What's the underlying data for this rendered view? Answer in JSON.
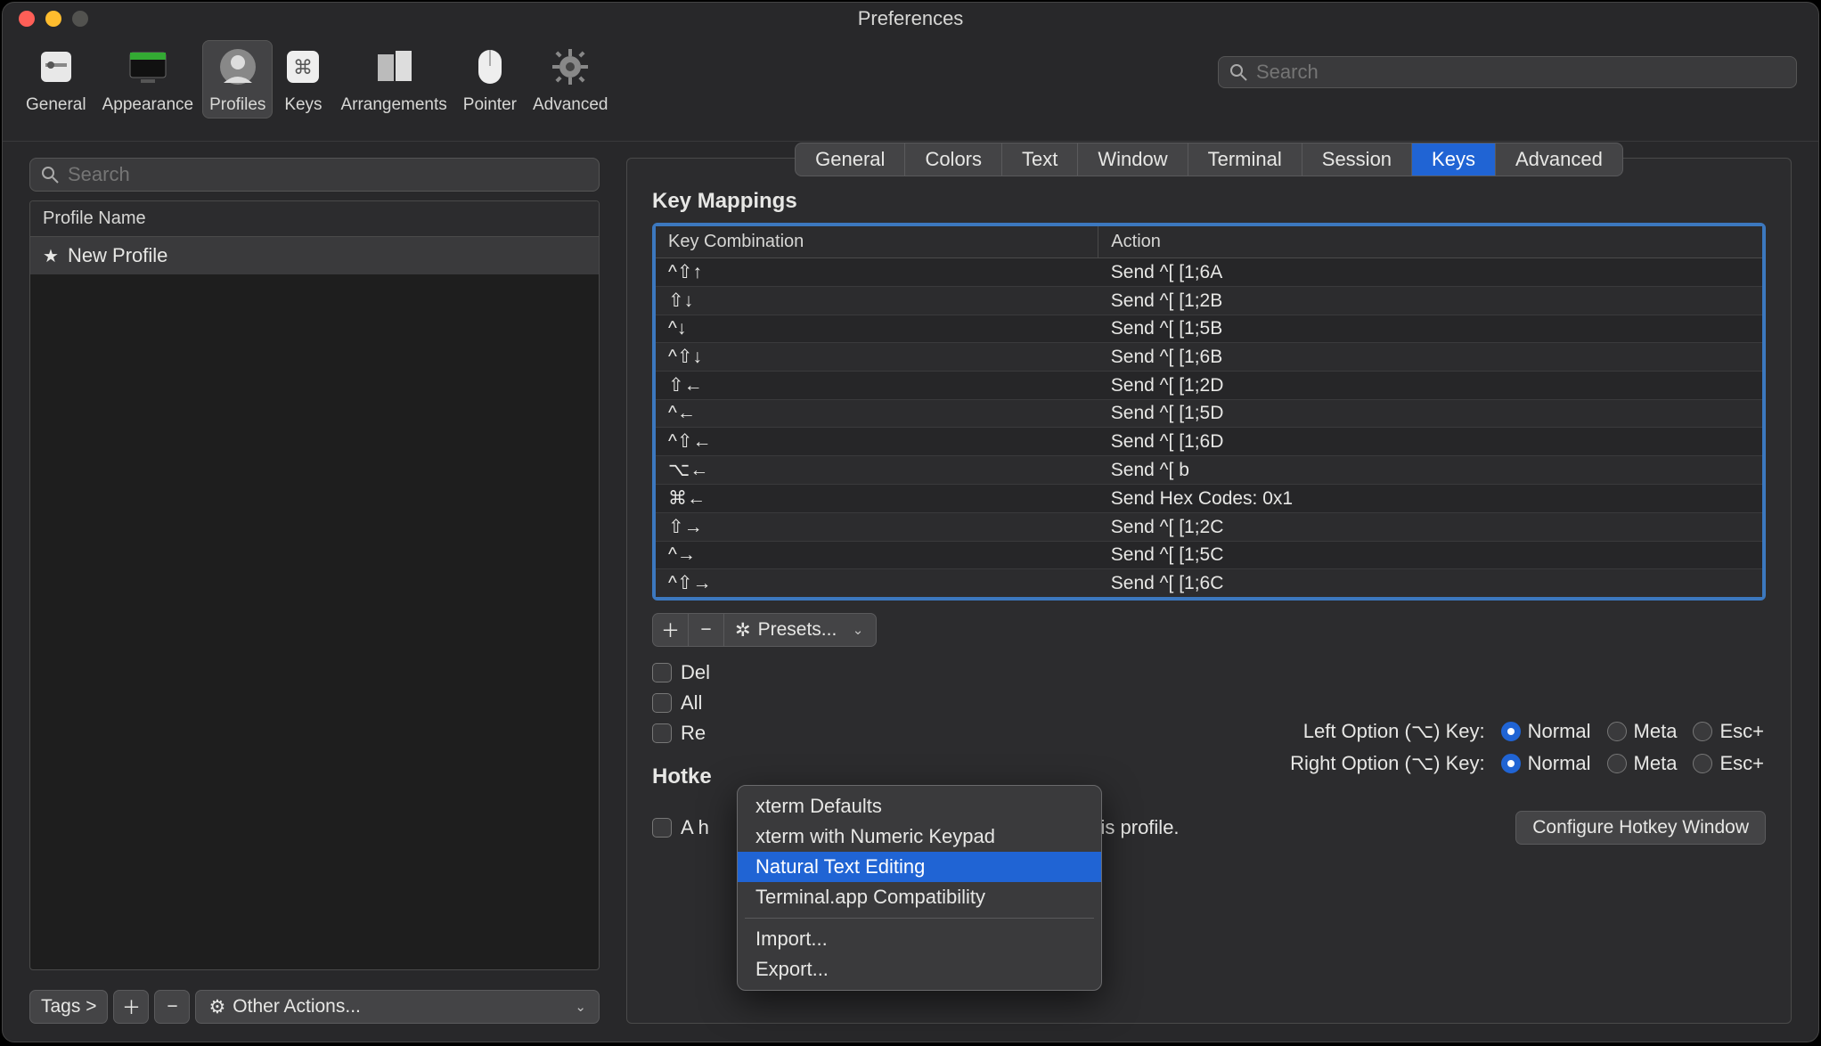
{
  "window_title": "Preferences",
  "toolbar": {
    "items": [
      {
        "label": "General"
      },
      {
        "label": "Appearance"
      },
      {
        "label": "Profiles"
      },
      {
        "label": "Keys"
      },
      {
        "label": "Arrangements"
      },
      {
        "label": "Pointer"
      },
      {
        "label": "Advanced"
      }
    ],
    "search_placeholder": "Search"
  },
  "sidebar": {
    "search_placeholder": "Search",
    "header": "Profile Name",
    "profiles": [
      {
        "name": "New Profile",
        "starred": true
      }
    ],
    "footer": {
      "tags_label": "Tags >",
      "other_actions": "Other Actions..."
    }
  },
  "subtabs": [
    "General",
    "Colors",
    "Text",
    "Window",
    "Terminal",
    "Session",
    "Keys",
    "Advanced"
  ],
  "active_subtab": "Keys",
  "section_title": "Key Mappings",
  "table": {
    "columns": [
      "Key Combination",
      "Action"
    ],
    "rows": [
      {
        "k": "^⇧↑",
        "a": "Send ^[ [1;6A"
      },
      {
        "k": "⇧↓",
        "a": "Send ^[ [1;2B"
      },
      {
        "k": "^↓",
        "a": "Send ^[ [1;5B"
      },
      {
        "k": "^⇧↓",
        "a": "Send ^[ [1;6B"
      },
      {
        "k": "⇧←",
        "a": "Send ^[ [1;2D"
      },
      {
        "k": "^←",
        "a": "Send ^[ [1;5D"
      },
      {
        "k": "^⇧←",
        "a": "Send ^[ [1;6D"
      },
      {
        "k": "⌥←",
        "a": "Send ^[ b"
      },
      {
        "k": "⌘←",
        "a": "Send Hex Codes: 0x1"
      },
      {
        "k": "⇧→",
        "a": "Send ^[ [1;2C"
      },
      {
        "k": "^→",
        "a": "Send ^[ [1;5C"
      },
      {
        "k": "^⇧→",
        "a": "Send ^[ [1;6C"
      }
    ]
  },
  "presets_label": "Presets...",
  "checkboxes": {
    "delete": "Del",
    "allow": "All",
    "report": "Re",
    "hotkey_section": "Hotke",
    "hotkey_text_prefix": "A h",
    "hotkey_text_suffix": "ith this profile."
  },
  "configure_btn": "Configure Hotkey Window",
  "option_keys": {
    "left_label": "Left Option (⌥) Key:",
    "right_label": "Right Option (⌥) Key:",
    "opts": [
      "Normal",
      "Meta",
      "Esc+"
    ]
  },
  "menu": {
    "items": [
      {
        "label": "xterm Defaults"
      },
      {
        "label": "xterm with Numeric Keypad"
      },
      {
        "label": "Natural Text Editing",
        "hl": true
      },
      {
        "label": "Terminal.app Compatibility"
      }
    ],
    "sep": true,
    "items2": [
      {
        "label": "Import..."
      },
      {
        "label": "Export..."
      }
    ]
  }
}
